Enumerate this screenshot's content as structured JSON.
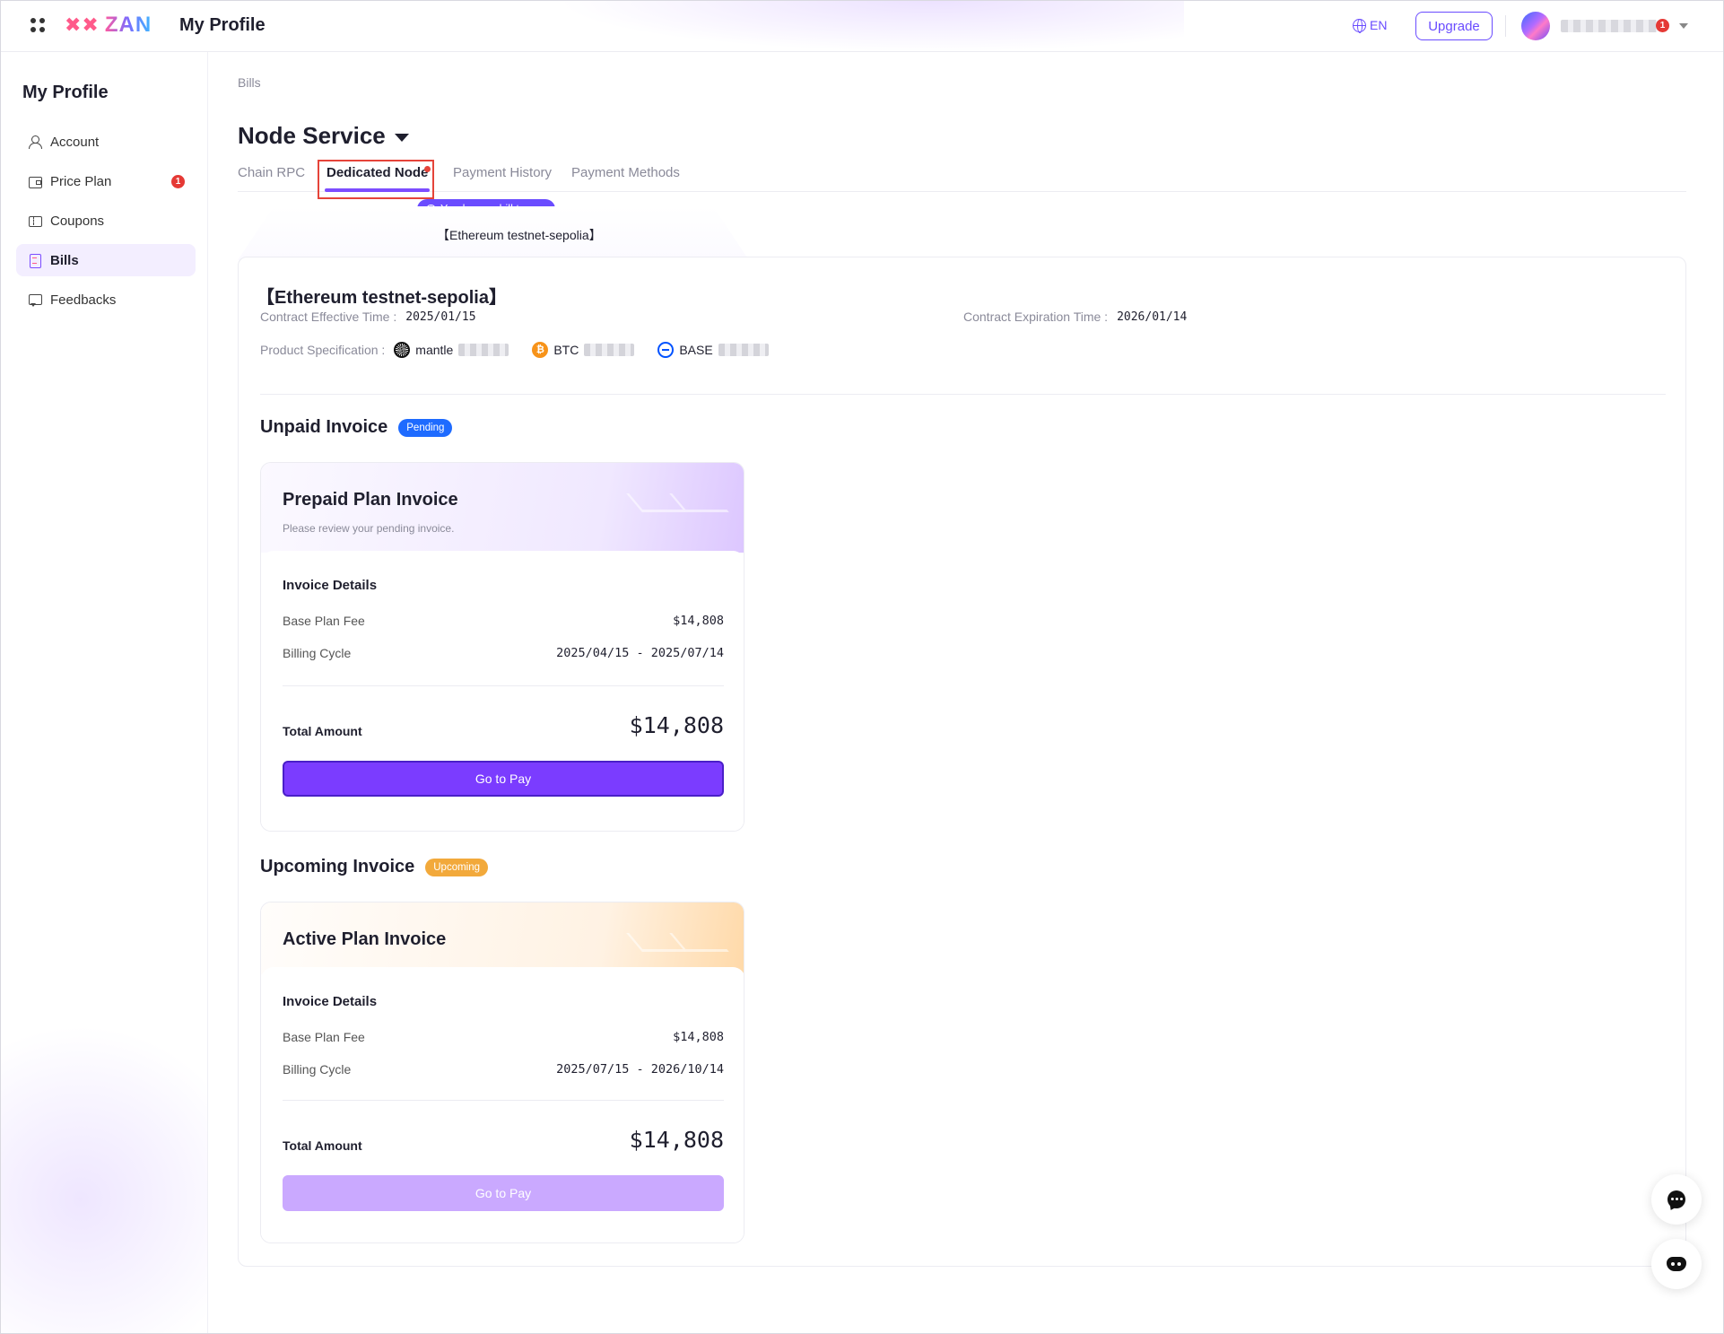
{
  "topbar": {
    "logo_text": "ZAN",
    "title": "My Profile",
    "language": "EN",
    "upgrade_label": "Upgrade",
    "notification_count": "1"
  },
  "sidebar": {
    "title": "My Profile",
    "items": [
      {
        "label": "Account",
        "icon": "user-icon"
      },
      {
        "label": "Price Plan",
        "icon": "wallet-icon",
        "badge": "1"
      },
      {
        "label": "Coupons",
        "icon": "coupon-icon"
      },
      {
        "label": "Bills",
        "icon": "bill-icon",
        "active": true
      },
      {
        "label": "Feedbacks",
        "icon": "feedback-icon"
      }
    ]
  },
  "main": {
    "breadcrumb": "Bills",
    "page_title": "Node Service",
    "tabs": [
      {
        "label": "Chain RPC"
      },
      {
        "label": "Dedicated Node",
        "active": true
      },
      {
        "label": "Payment History"
      },
      {
        "label": "Payment Methods"
      }
    ],
    "bill_tip": "You have a bill to pay",
    "network_tab": "【Ethereum testnet-sepolia】",
    "network": {
      "title": "【Ethereum testnet-sepolia】",
      "effective_label": "Contract Effective Time :",
      "effective_value": "2025/01/15",
      "expiration_label": "Contract Expiration Time :",
      "expiration_value": "2026/01/14",
      "spec_label": "Product Specification :",
      "chains": [
        "mantle",
        "BTC",
        "BASE"
      ]
    },
    "unpaid": {
      "section_title": "Unpaid Invoice",
      "badge": "Pending",
      "card_title": "Prepaid Plan Invoice",
      "card_subtitle": "Please review your pending invoice.",
      "details_label": "Invoice Details",
      "base_fee_label": "Base Plan Fee",
      "base_fee_value": "$14,808",
      "cycle_label": "Billing Cycle",
      "cycle_value": "2025/04/15 - 2025/07/14",
      "total_label": "Total Amount",
      "total_value": "$14,808",
      "pay_label": "Go to Pay"
    },
    "upcoming": {
      "section_title": "Upcoming Invoice",
      "badge": "Upcoming",
      "card_title": "Active Plan Invoice",
      "details_label": "Invoice Details",
      "base_fee_label": "Base Plan Fee",
      "base_fee_value": "$14,808",
      "cycle_label": "Billing Cycle",
      "cycle_value": "2025/07/15 - 2026/10/14",
      "total_label": "Total Amount",
      "total_value": "$14,808",
      "pay_label": "Go to Pay"
    }
  },
  "colors": {
    "accent": "#7b3cff",
    "pending": "#1e6bff",
    "upcoming": "#f2a93b",
    "alert": "#e53935"
  }
}
